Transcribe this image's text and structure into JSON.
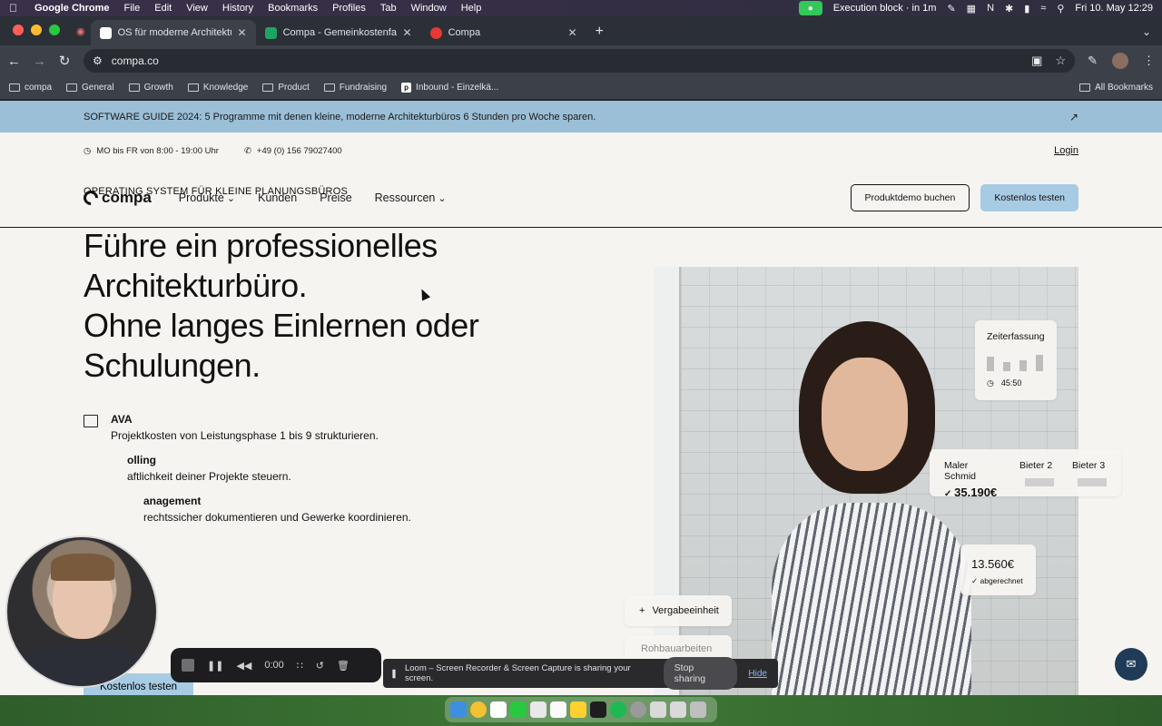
{
  "menubar": {
    "app_name": "Google Chrome",
    "items": [
      "File",
      "Edit",
      "View",
      "History",
      "Bookmarks",
      "Profiles",
      "Tab",
      "Window",
      "Help"
    ],
    "status_text": "Execution block · in 1m",
    "datetime": "Fri 10. May  12:29"
  },
  "tabs": [
    {
      "title": "OS für moderne Architekturbüros",
      "fav_color": "#ffffff",
      "active": true
    },
    {
      "title": "Compa - Gemeinkostenfaktor",
      "fav_color": "#1fa463",
      "active": false
    },
    {
      "title": "Compa",
      "fav_color": "#e53935",
      "active": false
    }
  ],
  "omnibox": {
    "url": "compa.co"
  },
  "bookmarks": {
    "items": [
      "compa",
      "General",
      "Growth",
      "Knowledge",
      "Product",
      "Fundraising",
      "Inbound - Einzelkä..."
    ],
    "all_label": "All Bookmarks"
  },
  "banner": {
    "text": "SOFTWARE GUIDE 2024: 5 Programme mit denen kleine, moderne Architekturbüros 6 Stunden pro Woche sparen.",
    "arrow": "↗"
  },
  "topinfo": {
    "hours": "MO bis FR von 8:00 - 19:00 Uhr",
    "phone": "+49 (0) 156 79027400",
    "login": "Login"
  },
  "nav": {
    "logo": "compa",
    "items": [
      {
        "label": "Produkte",
        "dropdown": true
      },
      {
        "label": "Kunden",
        "dropdown": false
      },
      {
        "label": "Preise",
        "dropdown": false
      },
      {
        "label": "Ressourcen",
        "dropdown": true
      }
    ],
    "demo_button": "Produktdemo buchen",
    "trial_button": "Kostenlos testen"
  },
  "hero": {
    "eyebrow": "OPERATING SYSTEM FÜR KLEINE PLANUNGSBÜROS",
    "headline_1": "Führe ein professionelles",
    "headline_2": "Architekturbüro.",
    "headline_3": "Ohne langes Einlernen oder",
    "headline_4": "Schulungen.",
    "features": [
      {
        "title": "AVA",
        "desc": "Projektkosten von Leistungsphase 1 bis 9 strukturieren."
      },
      {
        "title": "olling",
        "desc": "aftlichkeit deiner Projekte steuern."
      },
      {
        "title": "anagement",
        "desc": "rechtssicher dokumentieren und Gewerke koordinieren."
      }
    ],
    "cta": "Kostenlos testen"
  },
  "cards": {
    "zeit_title": "Zeiterfassung",
    "zeit_time": "45:50",
    "bieter": [
      {
        "label": "Maler Schmid",
        "value": "35.190€"
      },
      {
        "label": "Bieter 2",
        "value": ""
      },
      {
        "label": "Bieter 3",
        "value": ""
      }
    ],
    "abgerechnet_value": "13.560€",
    "abgerechnet_label": "abgerechnet",
    "vergabe": "Vergabeeinheit",
    "rohbau": "Rohbauarbeiten"
  },
  "loom": {
    "timer": "0:00",
    "share_text": "Loom – Screen Recorder & Screen Capture is sharing your screen.",
    "stop_label": "Stop sharing",
    "hide_label": "Hide"
  },
  "colors": {
    "accent": "#a8cbe4",
    "banner": "#9bbfd7",
    "page_bg": "#f6f4f1",
    "chat": "#1f3b57"
  }
}
